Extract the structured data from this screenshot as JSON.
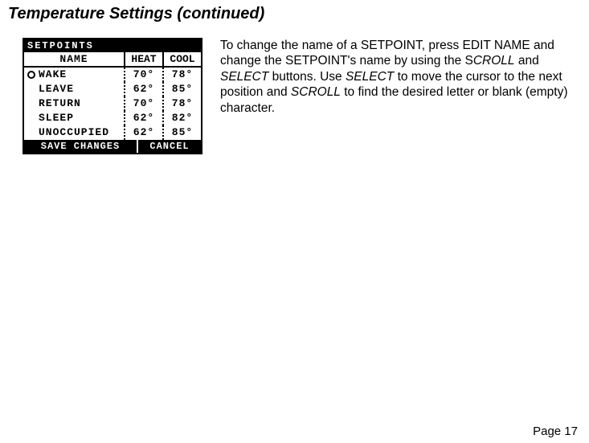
{
  "title": "Temperature Settings (continued)",
  "device": {
    "top_label": "SETPOINTS",
    "head_name": "NAME",
    "head_heat": "HEAT",
    "head_cool": "COOL",
    "rows": [
      {
        "name": "WAKE",
        "heat": "70°",
        "cool": "78°",
        "selected": true
      },
      {
        "name": "LEAVE",
        "heat": "62°",
        "cool": "85°",
        "selected": false
      },
      {
        "name": "RETURN",
        "heat": "70°",
        "cool": "78°",
        "selected": false
      },
      {
        "name": "SLEEP",
        "heat": "62°",
        "cool": "82°",
        "selected": false
      },
      {
        "name": "UNOCCUPIED",
        "heat": "62°",
        "cool": "85°",
        "selected": false
      }
    ],
    "foot_left": "SAVE CHANGES",
    "foot_right": "CANCEL"
  },
  "para": {
    "t1": "To change the name of a SETPOINT, press EDIT NAME and change the SETPOINT's name by using the S",
    "t2": "CROLL",
    "t3": " and ",
    "t4": "SELECT",
    "t5": " buttons. Use ",
    "t6": "SELECT",
    "t7": " to move the cursor to the next position and ",
    "t8": "SCROLL",
    "t9": " to find the desired letter or blank (empty) character."
  },
  "page": "Page 17"
}
